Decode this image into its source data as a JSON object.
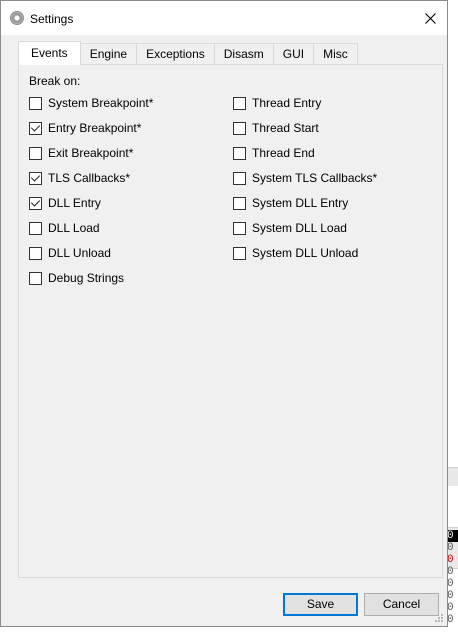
{
  "window": {
    "title": "Settings",
    "icon": "gear-icon",
    "close_icon": "close-icon"
  },
  "tabs": [
    {
      "label": "Events",
      "active": true
    },
    {
      "label": "Engine",
      "active": false
    },
    {
      "label": "Exceptions",
      "active": false
    },
    {
      "label": "Disasm",
      "active": false
    },
    {
      "label": "GUI",
      "active": false
    },
    {
      "label": "Misc",
      "active": false
    }
  ],
  "events": {
    "group_label": "Break on:",
    "left_column": [
      {
        "label": "System Breakpoint*",
        "checked": false
      },
      {
        "label": "Entry Breakpoint*",
        "checked": true
      },
      {
        "label": "Exit Breakpoint*",
        "checked": false
      },
      {
        "label": "TLS Callbacks*",
        "checked": true
      },
      {
        "label": "DLL Entry",
        "checked": true
      },
      {
        "label": "DLL Load",
        "checked": false
      },
      {
        "label": "DLL Unload",
        "checked": false
      },
      {
        "label": "Debug Strings",
        "checked": false
      }
    ],
    "right_column": [
      {
        "label": "Thread Entry",
        "checked": false
      },
      {
        "label": "Thread Start",
        "checked": false
      },
      {
        "label": "Thread End",
        "checked": false
      },
      {
        "label": "System TLS Callbacks*",
        "checked": false
      },
      {
        "label": "System DLL Entry",
        "checked": false
      },
      {
        "label": "System DLL Load",
        "checked": false
      },
      {
        "label": "System DLL Unload",
        "checked": false
      }
    ]
  },
  "buttons": {
    "save_label": "Save",
    "cancel_label": "Cancel"
  },
  "background": {
    "column_digits": [
      "0",
      "0",
      "0",
      "0",
      "0",
      "0",
      "0",
      "0"
    ]
  },
  "colors": {
    "accent": "#0078d7",
    "dialog_bg": "#f0f0f0",
    "background_highlight_text": "#d00000"
  }
}
